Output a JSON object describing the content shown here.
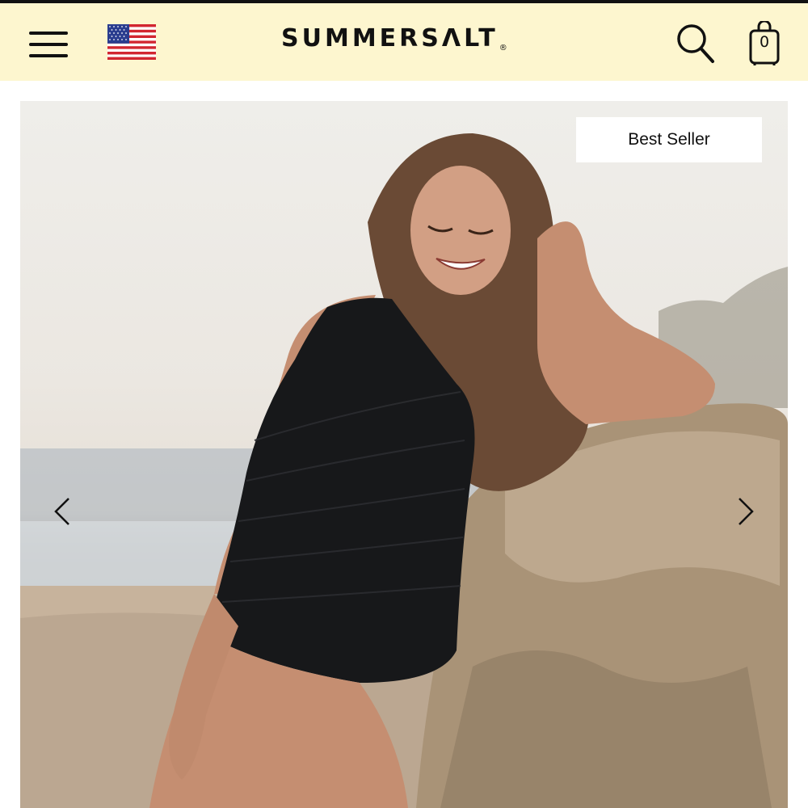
{
  "header": {
    "logo_text": "SUMMERSΛLT",
    "logo_registered": "®",
    "cart_count": "0",
    "background": "#fdf6cf",
    "icons": {
      "menu": "hamburger-menu-icon",
      "region": "us-flag-icon",
      "search": "search-icon",
      "cart": "shopping-bag-icon"
    }
  },
  "hero": {
    "badge": "Best Seller",
    "prev_icon": "chevron-left-icon",
    "next_icon": "chevron-right-icon"
  }
}
